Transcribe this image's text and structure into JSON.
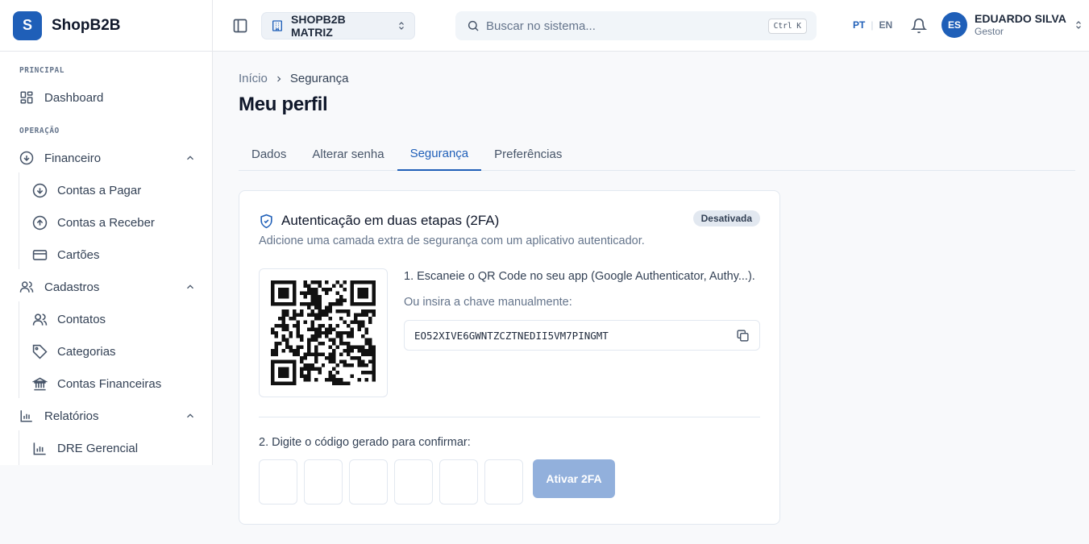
{
  "brand": {
    "logo_letter": "S",
    "name": "ShopB2B",
    "color": "#1f5fb8"
  },
  "sidebar": {
    "sections": {
      "principal": "PRINCIPAL",
      "operacao": "OPERAÇÃO"
    },
    "items": {
      "dashboard": {
        "label": "Dashboard",
        "icon": "grid-icon"
      },
      "financeiro": {
        "label": "Financeiro",
        "icon": "arrow-down-circle-icon",
        "expanded": true
      },
      "contas_pagar": {
        "label": "Contas a Pagar",
        "icon": "arrow-down-circle-icon"
      },
      "contas_receber": {
        "label": "Contas a Receber",
        "icon": "arrow-up-circle-icon"
      },
      "cartoes": {
        "label": "Cartões",
        "icon": "credit-card-icon"
      },
      "cadastros": {
        "label": "Cadastros",
        "icon": "users-icon",
        "expanded": true
      },
      "contatos": {
        "label": "Contatos",
        "icon": "users-icon"
      },
      "categorias": {
        "label": "Categorias",
        "icon": "tag-icon"
      },
      "contas_financeiras": {
        "label": "Contas Financeiras",
        "icon": "bank-icon"
      },
      "relatorios": {
        "label": "Relatórios",
        "icon": "bar-chart-icon",
        "expanded": true
      },
      "dre": {
        "label": "DRE Gerencial",
        "icon": "bar-chart-icon"
      }
    }
  },
  "header": {
    "company": "SHOPB2B MATRIZ",
    "search_placeholder": "Buscar no sistema...",
    "search_shortcut": "Ctrl K",
    "lang_pt": "PT",
    "lang_sep": "|",
    "lang_en": "EN",
    "user": {
      "initials": "ES",
      "name": "EDUARDO SILVA",
      "role": "Gestor"
    }
  },
  "breadcrumb": {
    "home": "Início",
    "current": "Segurança"
  },
  "page_title": "Meu perfil",
  "tabs": [
    {
      "label": "Dados",
      "active": false
    },
    {
      "label": "Alterar senha",
      "active": false
    },
    {
      "label": "Segurança",
      "active": true
    },
    {
      "label": "Preferências",
      "active": false
    }
  ],
  "twofa": {
    "title": "Autenticação em duas etapas (2FA)",
    "status": "Desativada",
    "description": "Adicione uma camada extra de segurança com um aplicativo autenticador.",
    "step1": "1. Escaneie o QR Code no seu app (Google Authenticator, Authy...).",
    "manual_label": "Ou insira a chave manualmente:",
    "secret": "EO52XIVE6GWNTZCZTNEDII5VM7PINGMT",
    "step2": "2. Digite o código gerado para confirmar:",
    "activate_label": "Ativar 2FA",
    "code_digits": [
      "",
      "",
      "",
      "",
      "",
      ""
    ]
  }
}
